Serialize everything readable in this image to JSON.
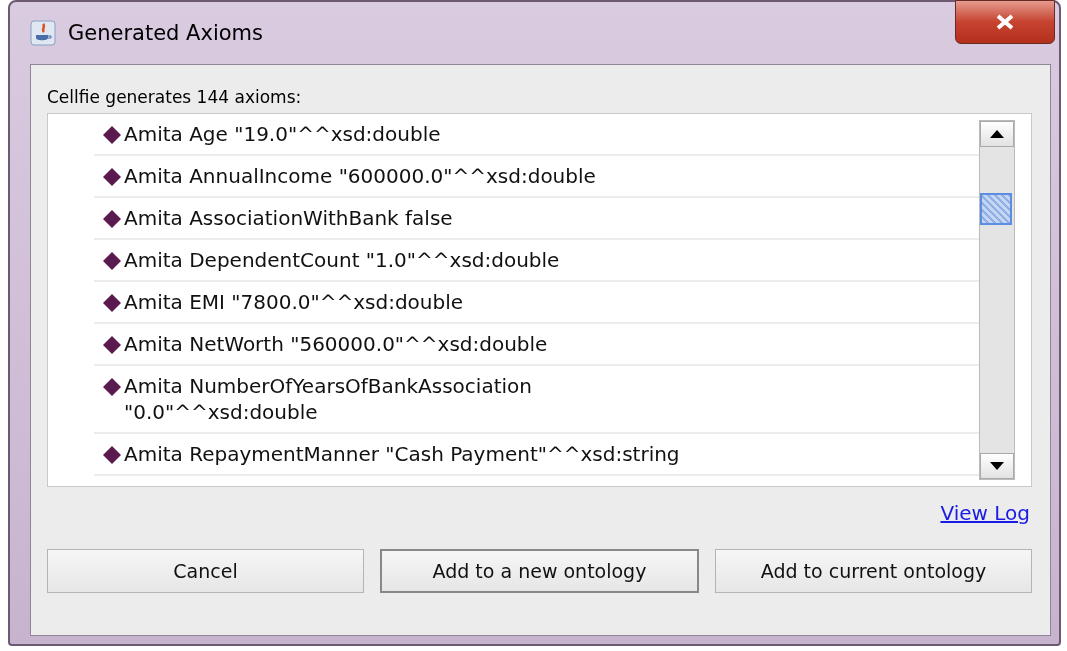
{
  "window": {
    "title": "Generated Axioms"
  },
  "summary": "Cellfie generates 144 axioms:",
  "axioms": [
    {
      "text": "Amita Age \"19.0\"^^xsd:double"
    },
    {
      "text": "Amita AnnualIncome \"600000.0\"^^xsd:double"
    },
    {
      "text": "Amita AssociationWithBank false"
    },
    {
      "text": "Amita DependentCount \"1.0\"^^xsd:double"
    },
    {
      "text": "Amita EMI \"7800.0\"^^xsd:double"
    },
    {
      "text": "Amita NetWorth \"560000.0\"^^xsd:double"
    },
    {
      "text": "Amita NumberOfYearsOfBankAssociation \"0.0\"^^xsd:double"
    },
    {
      "text": "Amita RepaymentManner \"Cash Payment\"^^xsd:string"
    }
  ],
  "view_log": "View Log",
  "buttons": [
    {
      "label": "Cancel",
      "focused": false
    },
    {
      "label": "Add to a new ontology",
      "focused": true
    },
    {
      "label": "Add to current ontology",
      "focused": false
    }
  ]
}
